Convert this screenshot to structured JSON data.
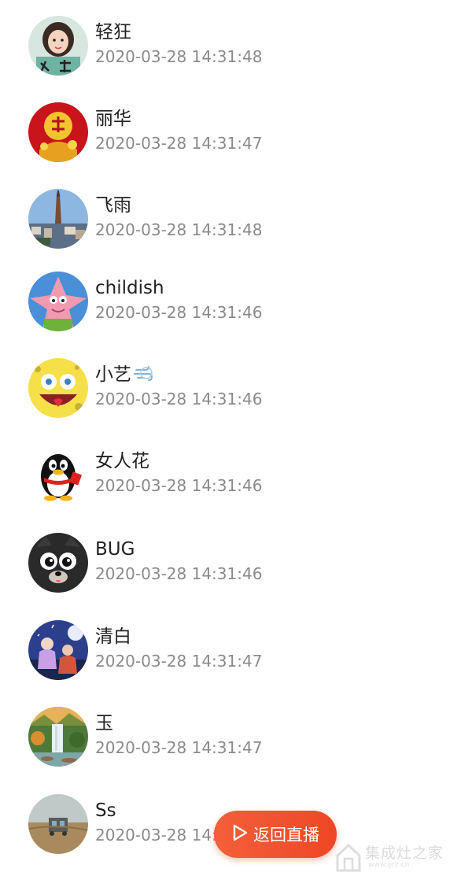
{
  "viewers": [
    {
      "name": "轻狂",
      "time": "2020-03-28 14:31:48",
      "avatar_icon": "girl-portrait-avatar"
    },
    {
      "name": "丽华",
      "time": "2020-03-28 14:31:47",
      "avatar_icon": "red-fortune-avatar"
    },
    {
      "name": "飞雨",
      "time": "2020-03-28 14:31:48",
      "avatar_icon": "city-tower-avatar"
    },
    {
      "name": "childish",
      "time": "2020-03-28 14:31:46",
      "avatar_icon": "pink-starfish-avatar"
    },
    {
      "name": "小艺",
      "time": "2020-03-28 14:31:46",
      "avatar_icon": "yellow-sponge-avatar",
      "badge_icon": "wind-emoji-icon"
    },
    {
      "name": "女人花",
      "time": "2020-03-28 14:31:46",
      "avatar_icon": "penguin-avatar"
    },
    {
      "name": "BUG",
      "time": "2020-03-28 14:31:46",
      "avatar_icon": "black-cartoon-cat-avatar"
    },
    {
      "name": "清白",
      "time": "2020-03-28 14:31:47",
      "avatar_icon": "night-anime-avatar"
    },
    {
      "name": "玉",
      "time": "2020-03-28 14:31:47",
      "avatar_icon": "waterfall-landscape-avatar"
    },
    {
      "name": "Ss",
      "time": "2020-03-28 14:31:47",
      "avatar_icon": "field-photo-avatar"
    }
  ],
  "back_live_button": {
    "label": "返回直播",
    "icon": "play-outline-icon",
    "color": "#ef4b2a"
  },
  "watermark": {
    "text": "集成灶之家",
    "subtext": "www.ijcz.cn",
    "icon": "house-logo-icon"
  },
  "colors": {
    "name": "#222222",
    "time": "#8a8a8a"
  }
}
